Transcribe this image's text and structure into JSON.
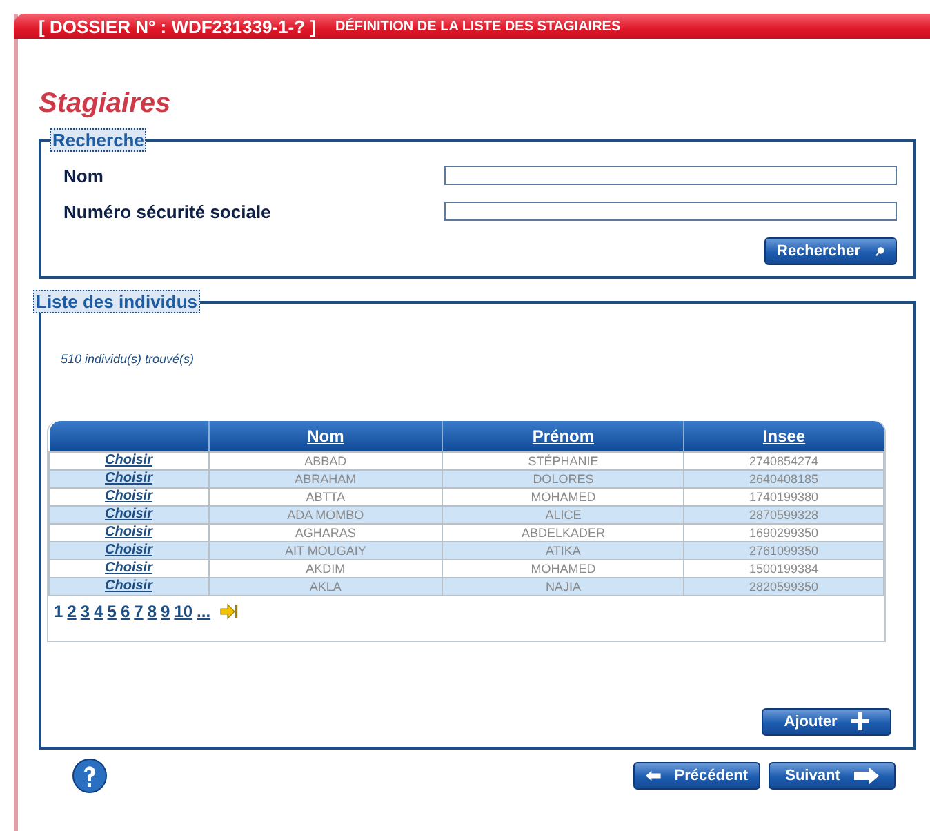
{
  "header": {
    "dossier": "[ DOSSIER N° : WDF231339-1-? ]",
    "title": "DÉFINITION DE LA LISTE DES STAGIAIRES"
  },
  "page_title": "Stagiaires",
  "search": {
    "legend": "Recherche",
    "fields": [
      {
        "label": "Nom"
      },
      {
        "label": "Numéro sécurité sociale"
      }
    ],
    "button": "Rechercher"
  },
  "results": {
    "legend": "Liste des individus",
    "count": "510 individu(s) trouvé(s)",
    "table": {
      "columns": [
        "",
        "Nom",
        "Prénom",
        "Insee"
      ],
      "rows": [
        {
          "action": "Choisir",
          "nom": "ABBAD",
          "prenom": "STÉPHANIE",
          "insee": "2740854274"
        },
        {
          "action": "Choisir",
          "nom": "ABRAHAM",
          "prenom": "DOLORES",
          "insee": "2640408185"
        },
        {
          "action": "Choisir",
          "nom": "ABTTA",
          "prenom": "MOHAMED",
          "insee": "1740199380"
        },
        {
          "action": "Choisir",
          "nom": "ADA MOMBO",
          "prenom": "ALICE",
          "insee": "2870599328"
        },
        {
          "action": "Choisir",
          "nom": "AGHARAS",
          "prenom": "ABDELKADER",
          "insee": "1690299350"
        },
        {
          "action": "Choisir",
          "nom": "AIT MOUGAIY",
          "prenom": "ATIKA",
          "insee": "2761099350"
        },
        {
          "action": "Choisir",
          "nom": "AKDIM",
          "prenom": "MOHAMED",
          "insee": "1500199384"
        },
        {
          "action": "Choisir",
          "nom": "AKLA",
          "prenom": "NAJIA",
          "insee": "2820599350"
        }
      ]
    },
    "pages": [
      {
        "label": "1",
        "selected": true
      },
      {
        "label": "2",
        "selected": false
      },
      {
        "label": "3",
        "selected": false
      },
      {
        "label": "4",
        "selected": false
      },
      {
        "label": "5",
        "selected": false
      },
      {
        "label": "6",
        "selected": false
      },
      {
        "label": "7",
        "selected": false
      },
      {
        "label": "8",
        "selected": false
      },
      {
        "label": "9",
        "selected": false
      },
      {
        "label": "10",
        "selected": false
      },
      {
        "label": "...",
        "selected": false
      }
    ],
    "add_button": "Ajouter"
  },
  "nav": {
    "previous": "Précédent",
    "next": "Suivant"
  }
}
